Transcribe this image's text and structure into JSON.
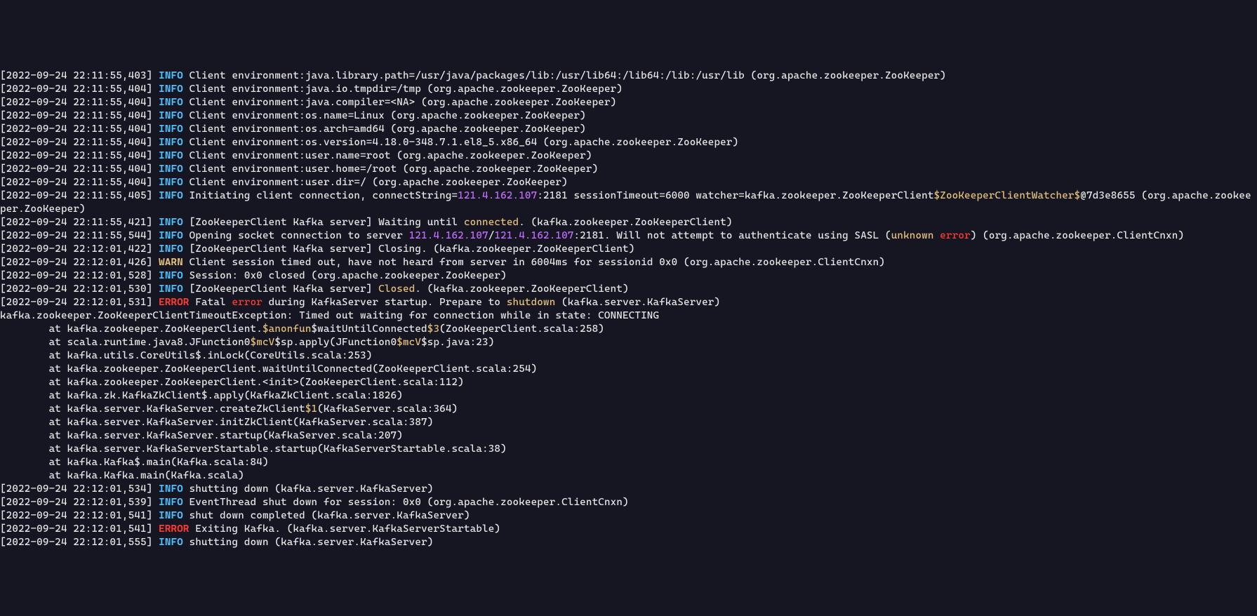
{
  "colors": {
    "bg": "#161622",
    "text": "#e6e6e6",
    "info": "#4fc1ff",
    "warn": "#e5c07b",
    "error": "#ff3b30",
    "keyword": "#e5c07b",
    "ip": "#c46cff"
  },
  "lines": [
    {
      "type": "log",
      "ts": "2022-09-24 22:11:55,403",
      "level": "INFO",
      "segs": [
        {
          "t": "Client environment:java.library.path=/usr/java/packages/lib:/usr/lib64:/lib64:/lib:/usr/lib (org.apache.zookeeper.ZooKeeper)"
        }
      ]
    },
    {
      "type": "log",
      "ts": "2022-09-24 22:11:55,404",
      "level": "INFO",
      "segs": [
        {
          "t": "Client environment:java.io.tmpdir=/tmp (org.apache.zookeeper.ZooKeeper)"
        }
      ]
    },
    {
      "type": "log",
      "ts": "2022-09-24 22:11:55,404",
      "level": "INFO",
      "segs": [
        {
          "t": "Client environment:java.compiler=<NA> (org.apache.zookeeper.ZooKeeper)"
        }
      ]
    },
    {
      "type": "log",
      "ts": "2022-09-24 22:11:55,404",
      "level": "INFO",
      "segs": [
        {
          "t": "Client environment:os.name=Linux (org.apache.zookeeper.ZooKeeper)"
        }
      ]
    },
    {
      "type": "log",
      "ts": "2022-09-24 22:11:55,404",
      "level": "INFO",
      "segs": [
        {
          "t": "Client environment:os.arch=amd64 (org.apache.zookeeper.ZooKeeper)"
        }
      ]
    },
    {
      "type": "log",
      "ts": "2022-09-24 22:11:55,404",
      "level": "INFO",
      "segs": [
        {
          "t": "Client environment:os.version=4.18.0-348.7.1.el8_5.x86_64 (org.apache.zookeeper.ZooKeeper)"
        }
      ]
    },
    {
      "type": "log",
      "ts": "2022-09-24 22:11:55,404",
      "level": "INFO",
      "segs": [
        {
          "t": "Client environment:user.name=root (org.apache.zookeeper.ZooKeeper)"
        }
      ]
    },
    {
      "type": "log",
      "ts": "2022-09-24 22:11:55,404",
      "level": "INFO",
      "segs": [
        {
          "t": "Client environment:user.home=/root (org.apache.zookeeper.ZooKeeper)"
        }
      ]
    },
    {
      "type": "log",
      "ts": "2022-09-24 22:11:55,404",
      "level": "INFO",
      "segs": [
        {
          "t": "Client environment:user.dir=/ (org.apache.zookeeper.ZooKeeper)"
        }
      ]
    },
    {
      "type": "log",
      "ts": "2022-09-24 22:11:55,405",
      "level": "INFO",
      "segs": [
        {
          "t": "Initiating client connection, connectString="
        },
        {
          "t": "121.4.162.107",
          "c": "ip"
        },
        {
          "t": ":2181 sessionTimeout=6000 watcher=kafka.zookeeper.ZooKeeperClient"
        },
        {
          "t": "$ZooKeeperClientWatcher$",
          "c": "kw"
        },
        {
          "t": "@7d3e8655 (org.apache.zookeeper.ZooKeeper)"
        }
      ]
    },
    {
      "type": "log",
      "ts": "2022-09-24 22:11:55,421",
      "level": "INFO",
      "segs": [
        {
          "t": "[ZooKeeperClient Kafka server] Waiting until "
        },
        {
          "t": "connected",
          "c": "kw"
        },
        {
          "t": ". (kafka.zookeeper.ZooKeeperClient)"
        }
      ]
    },
    {
      "type": "log",
      "ts": "2022-09-24 22:11:55,544",
      "level": "INFO",
      "segs": [
        {
          "t": "Opening socket connection to server "
        },
        {
          "t": "121.4.162.107",
          "c": "ip"
        },
        {
          "t": "/"
        },
        {
          "t": "121.4.162.107",
          "c": "ip"
        },
        {
          "t": ":2181. Will not attempt to authenticate using SASL ("
        },
        {
          "t": "unknown",
          "c": "kw"
        },
        {
          "t": " "
        },
        {
          "t": "error",
          "c": "err2"
        },
        {
          "t": ") (org.apache.zookeeper.ClientCnxn)"
        }
      ]
    },
    {
      "type": "log",
      "ts": "2022-09-24 22:12:01,422",
      "level": "INFO",
      "segs": [
        {
          "t": "[ZooKeeperClient Kafka server] Closing. (kafka.zookeeper.ZooKeeperClient)"
        }
      ]
    },
    {
      "type": "log",
      "ts": "2022-09-24 22:12:01,426",
      "level": "WARN",
      "segs": [
        {
          "t": "Client session timed out, have not heard from server in 6004ms for sessionid 0x0 (org.apache.zookeeper.ClientCnxn)"
        }
      ]
    },
    {
      "type": "log",
      "ts": "2022-09-24 22:12:01,528",
      "level": "INFO",
      "segs": [
        {
          "t": "Session: 0x0 closed (org.apache.zookeeper.ZooKeeper)"
        }
      ]
    },
    {
      "type": "log",
      "ts": "2022-09-24 22:12:01,530",
      "level": "INFO",
      "segs": [
        {
          "t": "[ZooKeeperClient Kafka server] "
        },
        {
          "t": "Closed",
          "c": "kw"
        },
        {
          "t": ". (kafka.zookeeper.ZooKeeperClient)"
        }
      ]
    },
    {
      "type": "log",
      "ts": "2022-09-24 22:12:01,531",
      "level": "ERROR",
      "segs": [
        {
          "t": "Fatal "
        },
        {
          "t": "error",
          "c": "err2"
        },
        {
          "t": " during KafkaServer startup. Prepare to "
        },
        {
          "t": "shutdown",
          "c": "kw"
        },
        {
          "t": " (kafka.server.KafkaServer)"
        }
      ]
    },
    {
      "type": "plain",
      "segs": [
        {
          "t": "kafka.zookeeper.ZooKeeperClientTimeoutException: Timed out waiting for connection while in state: CONNECTING"
        }
      ]
    },
    {
      "type": "plain",
      "segs": [
        {
          "t": "        at kafka.zookeeper.ZooKeeperClient."
        },
        {
          "t": "$anonfun",
          "c": "kw"
        },
        {
          "t": "$waitUntilConnected"
        },
        {
          "t": "$3",
          "c": "kw"
        },
        {
          "t": "(ZooKeeperClient.scala:258)"
        }
      ]
    },
    {
      "type": "plain",
      "segs": [
        {
          "t": "        at scala.runtime.java8.JFunction0"
        },
        {
          "t": "$mcV",
          "c": "kw"
        },
        {
          "t": "$sp.apply(JFunction0"
        },
        {
          "t": "$mcV",
          "c": "kw"
        },
        {
          "t": "$sp.java:23)"
        }
      ]
    },
    {
      "type": "plain",
      "segs": [
        {
          "t": "        at kafka.utils.CoreUtils$.inLock(CoreUtils.scala:253)"
        }
      ]
    },
    {
      "type": "plain",
      "segs": [
        {
          "t": "        at kafka.zookeeper.ZooKeeperClient.waitUntilConnected(ZooKeeperClient.scala:254)"
        }
      ]
    },
    {
      "type": "plain",
      "segs": [
        {
          "t": "        at kafka.zookeeper.ZooKeeperClient.<init>(ZooKeeperClient.scala:112)"
        }
      ]
    },
    {
      "type": "plain",
      "segs": [
        {
          "t": "        at kafka.zk.KafkaZkClient$.apply(KafkaZkClient.scala:1826)"
        }
      ]
    },
    {
      "type": "plain",
      "segs": [
        {
          "t": "        at kafka.server.KafkaServer.createZkClient"
        },
        {
          "t": "$1",
          "c": "kw"
        },
        {
          "t": "(KafkaServer.scala:364)"
        }
      ]
    },
    {
      "type": "plain",
      "segs": [
        {
          "t": "        at kafka.server.KafkaServer.initZkClient(KafkaServer.scala:387)"
        }
      ]
    },
    {
      "type": "plain",
      "segs": [
        {
          "t": "        at kafka.server.KafkaServer.startup(KafkaServer.scala:207)"
        }
      ]
    },
    {
      "type": "plain",
      "segs": [
        {
          "t": "        at kafka.server.KafkaServerStartable.startup(KafkaServerStartable.scala:38)"
        }
      ]
    },
    {
      "type": "plain",
      "segs": [
        {
          "t": "        at kafka.Kafka$.main(Kafka.scala:84)"
        }
      ]
    },
    {
      "type": "plain",
      "segs": [
        {
          "t": "        at kafka.Kafka.main(Kafka.scala)"
        }
      ]
    },
    {
      "type": "log",
      "ts": "2022-09-24 22:12:01,534",
      "level": "INFO",
      "segs": [
        {
          "t": "shutting down (kafka.server.KafkaServer)"
        }
      ]
    },
    {
      "type": "log",
      "ts": "2022-09-24 22:12:01,539",
      "level": "INFO",
      "segs": [
        {
          "t": "EventThread shut down for session: 0x0 (org.apache.zookeeper.ClientCnxn)"
        }
      ]
    },
    {
      "type": "log",
      "ts": "2022-09-24 22:12:01,541",
      "level": "INFO",
      "segs": [
        {
          "t": "shut down completed (kafka.server.KafkaServer)"
        }
      ]
    },
    {
      "type": "log",
      "ts": "2022-09-24 22:12:01,541",
      "level": "ERROR",
      "segs": [
        {
          "t": "Exiting Kafka. (kafka.server.KafkaServerStartable)"
        }
      ]
    },
    {
      "type": "log",
      "ts": "2022-09-24 22:12:01,555",
      "level": "INFO",
      "segs": [
        {
          "t": "shutting down (kafka.server.KafkaServer)"
        }
      ]
    }
  ]
}
